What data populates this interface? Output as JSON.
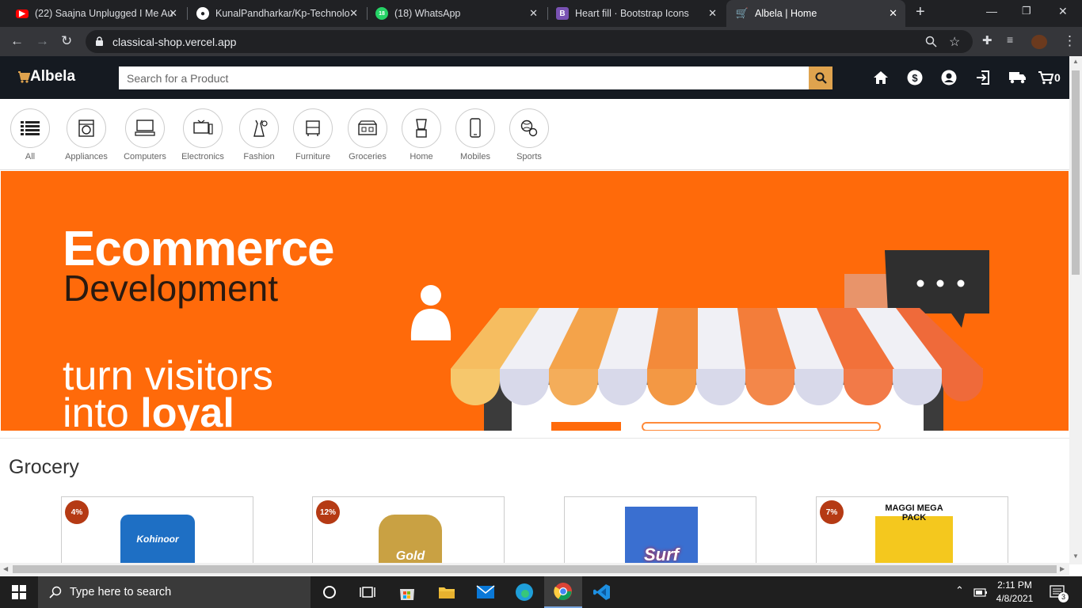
{
  "browser": {
    "tabs": [
      {
        "title": "(22) Saajna Unplugged I Me Au",
        "favicon": "youtube-icon",
        "color": "#ff0000"
      },
      {
        "title": "KunalPandharkar/Kp-Technolo",
        "favicon": "github-icon",
        "color": "#ffffff"
      },
      {
        "title": "(18) WhatsApp",
        "favicon": "whatsapp-icon",
        "color": "#25d366"
      },
      {
        "title": "Heart fill · Bootstrap Icons",
        "favicon": "bootstrap-icon",
        "color": "#7952b3"
      },
      {
        "title": "Albela | Home",
        "favicon": "albela-icon",
        "color": "#dfa34e"
      }
    ],
    "url": "classical-shop.vercel.app"
  },
  "header": {
    "logo": "Albela",
    "search_placeholder": "Search for a Product",
    "cart_count": "0",
    "accent": "#dfa34e"
  },
  "categories": [
    "All",
    "Appliances",
    "Computers",
    "Electronics",
    "Fashion",
    "Furniture",
    "Groceries",
    "Home",
    "Mobiles",
    "Sports"
  ],
  "banner": {
    "line1": "Ecommerce",
    "line2": "Development",
    "line3": "turn visitors",
    "line4a": "into",
    "line4b": "loyal",
    "bg": "#ff6a0a"
  },
  "grocery": {
    "title": "Grocery",
    "products": [
      {
        "discount": "4%",
        "brand": "Kohinoor"
      },
      {
        "discount": "12%",
        "brand": "Gold"
      },
      {
        "discount": "",
        "brand": "Surf"
      },
      {
        "discount": "7%",
        "brand": "MAGGI MEGA PACK"
      }
    ]
  },
  "taskbar": {
    "search_placeholder": "Type here to search",
    "time": "2:11 PM",
    "date": "4/8/2021",
    "notifications": "3"
  }
}
